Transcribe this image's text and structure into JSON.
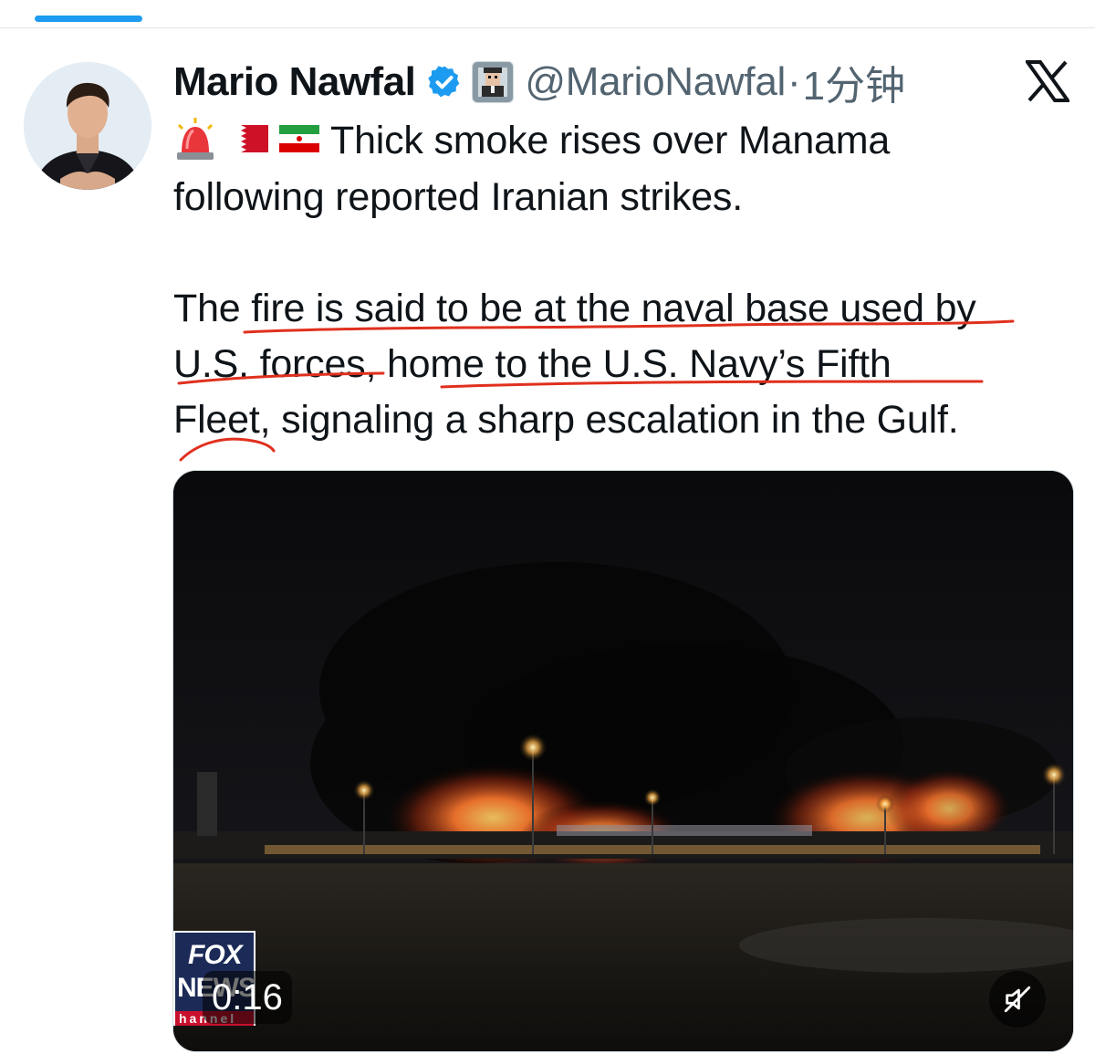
{
  "author": {
    "name": "Mario Nawfal",
    "handle": "@MarioNawfal",
    "separator": "·",
    "time": "1分钟"
  },
  "icons": {
    "verified": "verified-badge-icon",
    "affiliate": "affiliate-avatar-icon",
    "x_logo": "x-logo-icon",
    "siren": "siren-emoji",
    "flag_bahrain": "bahrain-flag-emoji",
    "flag_iran": "iran-flag-emoji",
    "mute": "muted-speaker-icon"
  },
  "colors": {
    "verified": "#1d9bf0",
    "annotation": "#e0301e",
    "tab_indicator": "#1d9bf0"
  },
  "tweet": {
    "line1": "Thick smoke rises over Manama",
    "line2": "following reported Iranian strikes.",
    "line3": "The fire is said to be at the naval base used by",
    "line4": "U.S. forces, home to the U.S. Navy’s Fifth",
    "line5": "Fleet, signaling a sharp escalation in the Gulf."
  },
  "media": {
    "duration": "0:16",
    "logo_top": "FOX",
    "logo_mid": "NEWS",
    "logo_bottom": "hannel"
  }
}
